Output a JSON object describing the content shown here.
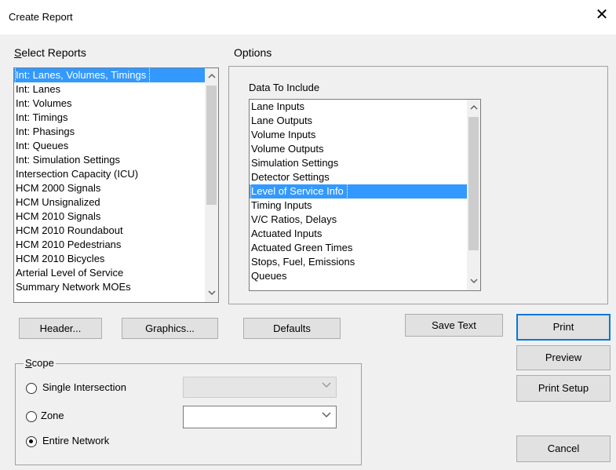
{
  "window": {
    "title": "Create Report",
    "close_glyph": "✕"
  },
  "select_reports": {
    "label": "Select Reports",
    "items": [
      "Int: Lanes, Volumes, Timings",
      "Int: Lanes",
      "Int: Volumes",
      "Int: Timings",
      "Int: Phasings",
      "Int: Queues",
      "Int: Simulation Settings",
      "Intersection Capacity (ICU)",
      "HCM 2000 Signals",
      "HCM Unsignalized",
      "HCM 2010 Signals",
      "HCM 2010 Roundabout",
      "HCM 2010 Pedestrians",
      "HCM 2010 Bicycles",
      "Arterial Level of Service",
      "Summary Network MOEs"
    ],
    "selected_index": 0
  },
  "options": {
    "label": "Options",
    "data_to_include": {
      "label": "Data To Include",
      "items": [
        "Lane Inputs",
        "Lane Outputs",
        "Volume Inputs",
        "Volume Outputs",
        "Simulation Settings",
        "Detector Settings",
        "Level of Service Info",
        "Timing Inputs",
        "V/C Ratios, Delays",
        "Actuated Inputs",
        "Actuated Green Times",
        "Stops, Fuel, Emissions",
        "Queues"
      ],
      "selected_index": 6
    }
  },
  "buttons": {
    "header": "Header...",
    "graphics": "Graphics...",
    "defaults": "Defaults",
    "save_text": "Save Text",
    "print": "Print",
    "preview": "Preview",
    "print_setup": "Print Setup",
    "cancel": "Cancel"
  },
  "scope": {
    "label": "Scope",
    "single_intersection": {
      "label": "Single Intersection",
      "checked": false,
      "value": ""
    },
    "zone": {
      "label": "Zone",
      "checked": false,
      "value": ""
    },
    "entire_network": {
      "label": "Entire Network",
      "checked": true
    }
  },
  "icons": {
    "scroll_up": "▲",
    "scroll_down": "▼",
    "dropdown": "chevron-down"
  }
}
